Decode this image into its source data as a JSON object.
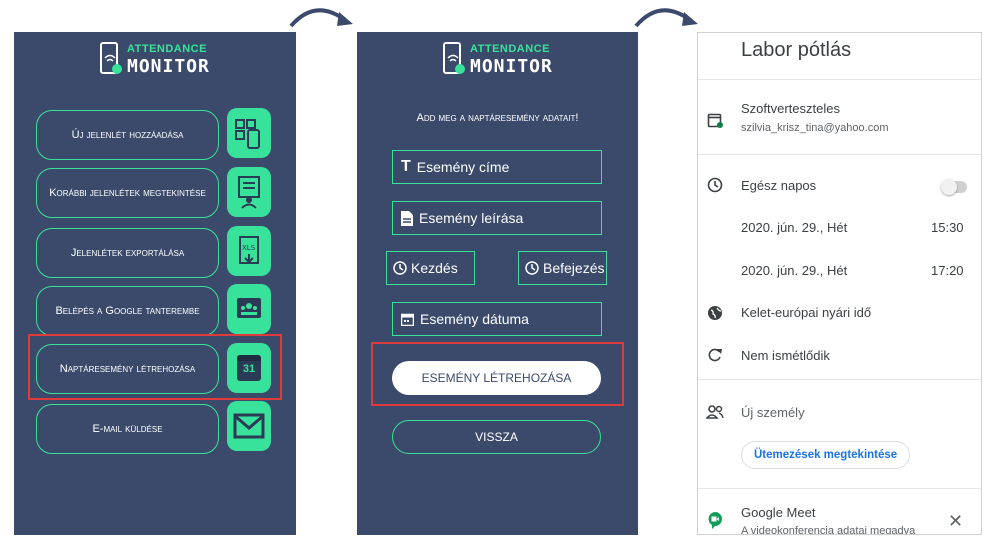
{
  "logo": {
    "line1": "ATTENDANCE",
    "line2": "MONITOR"
  },
  "menu": {
    "items": [
      {
        "label": "Új jelenlét hozzáadása",
        "icon": "qr-phone-icon"
      },
      {
        "label": "Korábbi jelenlétek megtekintése",
        "icon": "list-person-icon"
      },
      {
        "label": "Jelenlétek exportálása",
        "icon": "xls-export-icon"
      },
      {
        "label": "Belépés a Google tanterembe",
        "icon": "classroom-icon"
      },
      {
        "label": "Naptáresemény létrehozása",
        "icon": "calendar-icon",
        "calendar_day": "31"
      },
      {
        "label": "E-mail küldése",
        "icon": "mail-icon"
      }
    ]
  },
  "event_form": {
    "prompt": "Add meg a naptáresemény adatait!",
    "title_field": "Esemény címe",
    "description_field": "Esemény leírása",
    "start_button": "Kezdés",
    "end_button": "Befejezés",
    "date_field": "Esemény dátuma",
    "create_button": "ESEMÉNY LÉTREHOZÁSA",
    "back_button": "VISSZA"
  },
  "calendar": {
    "title": "Labor pótlás",
    "calendar_name": "Szoftverteszteles",
    "calendar_account": "szilvia_krisz_tina@yahoo.com",
    "all_day_label": "Egész napos",
    "start_date": "2020. jún. 29., Hét",
    "start_time": "15:30",
    "end_date": "2020. jún. 29., Hét",
    "end_time": "17:20",
    "timezone": "Kelet-európai nyári idő",
    "repeat": "Nem ismétlődik",
    "add_person": "Új személy",
    "schedules_button": "Ütemezések megtekintése",
    "meet_title": "Google Meet",
    "meet_sub": "A videokonferencia adatai megadva"
  },
  "colors": {
    "accent": "#39e29a",
    "screen_bg": "#3b4a6b",
    "highlight": "#e03b3b"
  }
}
